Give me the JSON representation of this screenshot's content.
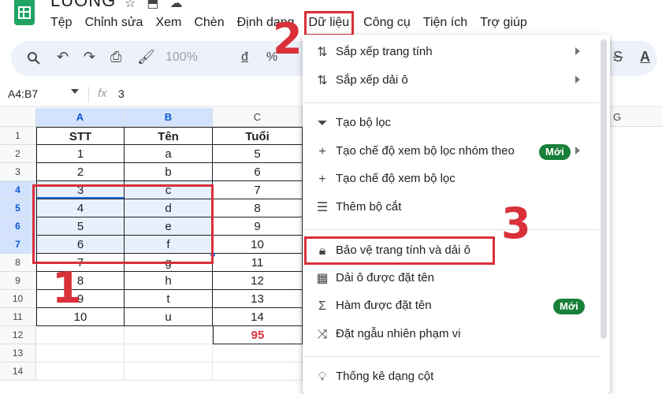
{
  "app": {
    "doc_title": "LUONG",
    "menu": [
      {
        "label": "Tệp"
      },
      {
        "label": "Chỉnh sửa"
      },
      {
        "label": "Xem"
      },
      {
        "label": "Chèn"
      },
      {
        "label": "Định dạng"
      },
      {
        "label": "Dữ liệu",
        "active": true
      },
      {
        "label": "Công cụ"
      },
      {
        "label": "Tiện ích"
      },
      {
        "label": "Trợ giúp"
      }
    ]
  },
  "toolbar": {
    "zoom": "100%",
    "currency": "đ",
    "percent": "%",
    "icons": [
      "search-icon",
      "undo-icon",
      "redo-icon",
      "print-icon",
      "paint-format-icon",
      "strikethrough-icon",
      "text-color-icon"
    ]
  },
  "formula_bar": {
    "name_box": "A4:B7",
    "fx": "fx",
    "value": "3"
  },
  "sheet": {
    "columns": [
      "A",
      "B",
      "C",
      "G"
    ],
    "rows": [
      {
        "n": "1",
        "a": "STT",
        "b": "Tên",
        "c": "Tuổi"
      },
      {
        "n": "2",
        "a": "1",
        "b": "a",
        "c": "5"
      },
      {
        "n": "3",
        "a": "2",
        "b": "b",
        "c": "6"
      },
      {
        "n": "4",
        "a": "3",
        "b": "c",
        "c": "7"
      },
      {
        "n": "5",
        "a": "4",
        "b": "d",
        "c": "8"
      },
      {
        "n": "6",
        "a": "5",
        "b": "e",
        "c": "9"
      },
      {
        "n": "7",
        "a": "6",
        "b": "f",
        "c": "10"
      },
      {
        "n": "8",
        "a": "7",
        "b": "g",
        "c": "11"
      },
      {
        "n": "9",
        "a": "8",
        "b": "h",
        "c": "12"
      },
      {
        "n": "10",
        "a": "9",
        "b": "t",
        "c": "13"
      },
      {
        "n": "11",
        "a": "10",
        "b": "u",
        "c": "14"
      },
      {
        "n": "12",
        "a": "",
        "b": "",
        "c": "95"
      },
      {
        "n": "13",
        "a": "",
        "b": "",
        "c": ""
      },
      {
        "n": "14",
        "a": "",
        "b": "",
        "c": ""
      }
    ]
  },
  "annotations": {
    "step1": "1",
    "step2": "2",
    "step3": "3"
  },
  "data_menu": {
    "items": [
      {
        "label": "Sắp xếp trang tính",
        "icon": "sort-icon",
        "submenu": true
      },
      {
        "label": "Sắp xếp dải ô",
        "icon": "sort-range-icon",
        "submenu": true
      },
      {
        "label": "Tạo bộ lọc",
        "icon": "filter-icon"
      },
      {
        "label": "Tạo chế độ xem bộ lọc nhóm theo",
        "icon": "plus-icon",
        "badge": "Mới",
        "submenu": true
      },
      {
        "label": "Tạo chế độ xem bộ lọc",
        "icon": "plus-icon"
      },
      {
        "label": "Thêm bộ cắt",
        "icon": "slicer-icon"
      },
      {
        "label": "Bảo vệ trang tính và dải ô",
        "icon": "lock-icon"
      },
      {
        "label": "Dải ô được đặt tên",
        "icon": "named-range-icon"
      },
      {
        "label": "Hàm được đặt tên",
        "icon": "sigma-icon",
        "badge": "Mới"
      },
      {
        "label": "Đặt ngẫu nhiên phạm vi",
        "icon": "shuffle-icon"
      },
      {
        "label": "Thống kê dạng cột",
        "icon": "lightbulb-icon"
      }
    ]
  }
}
